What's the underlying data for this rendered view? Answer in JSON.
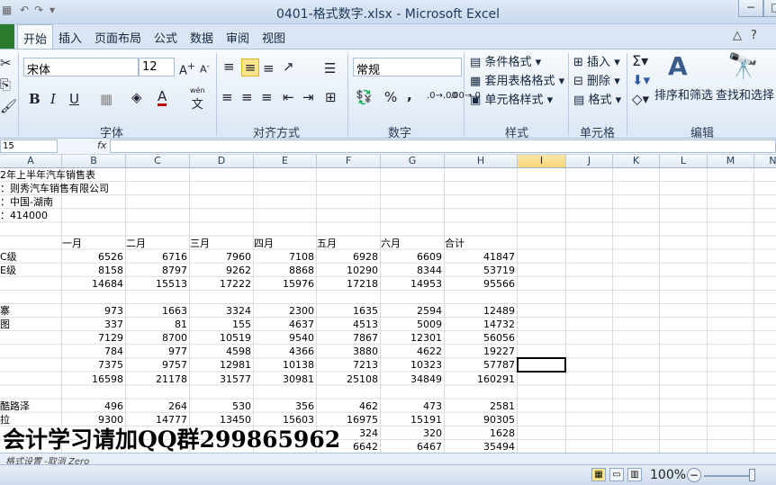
{
  "window": {
    "title": "0401-格式数字.xlsx - Microsoft Excel",
    "controls": [
      "−",
      "□"
    ]
  },
  "ribbon_tabs": [
    "开始",
    "插入",
    "页面布局",
    "公式",
    "数据",
    "审阅",
    "视图"
  ],
  "ribbon_right_icons": [
    "△",
    "?"
  ],
  "font_group": {
    "label": "字体",
    "font_name": "宋体",
    "font_size": "12",
    "bold": "B",
    "italic": "I",
    "underline": "U",
    "wen": "wén"
  },
  "align_group": {
    "label": "对齐方式"
  },
  "number_group": {
    "label": "数字",
    "format": "常规",
    "percent": "%",
    "comma": ","
  },
  "styles_group": {
    "label": "样式",
    "conditional": "条件格式",
    "table": "套用表格格式",
    "cell_styles": "单元格样式"
  },
  "cells_group": {
    "label": "单元格",
    "insert": "插入",
    "delete": "删除",
    "format": "格式"
  },
  "edit_group": {
    "label": "编辑",
    "sort": "排序和筛选",
    "find": "查找和选择"
  },
  "formula_bar": {
    "name_box": "15",
    "fx": "fx",
    "value": ""
  },
  "columns": [
    {
      "letter": "A",
      "active": false
    },
    {
      "letter": "B",
      "active": false
    },
    {
      "letter": "C",
      "active": false
    },
    {
      "letter": "D",
      "active": false
    },
    {
      "letter": "E",
      "active": false
    },
    {
      "letter": "F",
      "active": false
    },
    {
      "letter": "G",
      "active": false
    },
    {
      "letter": "H",
      "active": false
    },
    {
      "letter": "I",
      "active": true
    },
    {
      "letter": "J",
      "active": false
    },
    {
      "letter": "K",
      "active": false
    },
    {
      "letter": "L",
      "active": false
    },
    {
      "letter": "M",
      "active": false
    },
    {
      "letter": "N",
      "active": false
    }
  ],
  "sheet": {
    "header_rows": [
      {
        "row": 0,
        "text": "2年上半年汽车销售表"
      },
      {
        "row": 1,
        "text": "：则秀汽车销售有限公司"
      },
      {
        "row": 2,
        "text": "：中国-湖南"
      },
      {
        "row": 3,
        "text": "：414000"
      }
    ],
    "month_header": {
      "row": 5,
      "labels": [
        "一月",
        "二月",
        "三月",
        "四月",
        "五月",
        "六月",
        "合计"
      ]
    },
    "data_rows": [
      {
        "row": 6,
        "label": "C级",
        "values": [
          "6526",
          "6716",
          "7960",
          "7108",
          "6928",
          "6609",
          "41847"
        ]
      },
      {
        "row": 7,
        "label": "E级",
        "values": [
          "8158",
          "8797",
          "9262",
          "8868",
          "10290",
          "8344",
          "53719"
        ]
      },
      {
        "row": 8,
        "label": "",
        "values": [
          "14684",
          "15513",
          "17222",
          "15976",
          "17218",
          "14953",
          "95566"
        ]
      },
      {
        "row": 10,
        "label": "寨",
        "values": [
          "973",
          "1663",
          "3324",
          "2300",
          "1635",
          "2594",
          "12489"
        ]
      },
      {
        "row": 11,
        "label": "图",
        "values": [
          "337",
          "81",
          "155",
          "4637",
          "4513",
          "5009",
          "14732"
        ]
      },
      {
        "row": 12,
        "label": "",
        "values": [
          "7129",
          "8700",
          "10519",
          "9540",
          "7867",
          "12301",
          "56056"
        ]
      },
      {
        "row": 13,
        "label": "",
        "values": [
          "784",
          "977",
          "4598",
          "4366",
          "3880",
          "4622",
          "19227"
        ]
      },
      {
        "row": 14,
        "label": "",
        "values": [
          "7375",
          "9757",
          "12981",
          "10138",
          "7213",
          "10323",
          "57787"
        ]
      },
      {
        "row": 15,
        "label": "",
        "values": [
          "16598",
          "21178",
          "31577",
          "30981",
          "25108",
          "34849",
          "160291"
        ]
      },
      {
        "row": 17,
        "label": "酷路泽",
        "values": [
          "496",
          "264",
          "530",
          "356",
          "462",
          "473",
          "2581"
        ]
      },
      {
        "row": 18,
        "label": "拉",
        "values": [
          "9300",
          "14777",
          "13450",
          "15603",
          "16975",
          "15191",
          "90305"
        ]
      },
      {
        "row": 19,
        "label": "",
        "values": [
          "",
          "",
          "",
          "",
          "324",
          "320",
          "1628"
        ]
      },
      {
        "row": 20,
        "label": "",
        "values": [
          "",
          "",
          "",
          "",
          "6642",
          "6467",
          "35494"
        ]
      }
    ]
  },
  "watermark": "会计学习请加QQ群299865962",
  "sheet_tabs": "格式设置  -取消  Zero",
  "status": {
    "zoom": "100%"
  }
}
